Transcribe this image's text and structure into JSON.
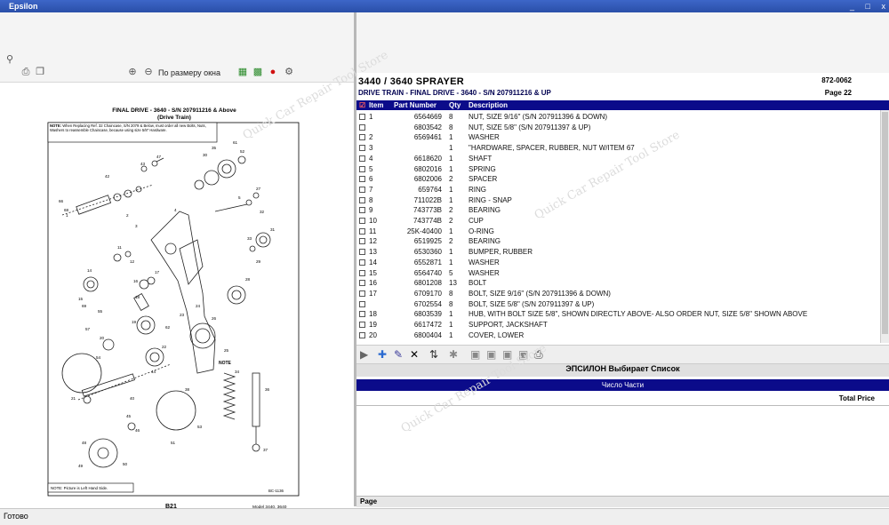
{
  "window": {
    "title": "Epsilon",
    "minimize": "_",
    "maximize": "□",
    "close": "x"
  },
  "left_toolbar": {
    "zoom_label": "По размеру окна"
  },
  "diagram": {
    "title": "FINAL DRIVE - 3640 - S/N 207911216 & Above",
    "subtitle": "(Drive Train)",
    "note_top_label": "NOTE:",
    "note_top_text": "When Replacing Ref. 32 Chaincase, S/N 2079 & Below, must order all new Bolts, Nuts, Washers to reassemble Chaincase, because using size 5/8\" Hardware.",
    "note_bottom": "NOTE: Picture is Left Hand Side.",
    "code": "BC-1136",
    "page_ref": "B21",
    "model_line1": "Model 3440, 3640",
    "model_line2": "Spra-Coupe Parts",
    "callouts": [
      "47",
      "43",
      "42",
      "35",
      "30",
      "61",
      "52",
      "27",
      "5",
      "1",
      "2",
      "3",
      "4",
      "11",
      "12",
      "14",
      "15",
      "16",
      "17",
      "18",
      "19",
      "20",
      "21",
      "22",
      "23",
      "24",
      "25",
      "26",
      "28",
      "29",
      "31",
      "32",
      "33",
      "34",
      "36",
      "37",
      "38",
      "40",
      "44",
      "45",
      "46",
      "48",
      "49",
      "50",
      "51",
      "53",
      "54",
      "55",
      "57",
      "62",
      "66",
      "68",
      "69"
    ]
  },
  "header": {
    "model_title": "3440 / 3640 SPRAYER",
    "model_code": "872-0062",
    "section_title": "DRIVE TRAIN - FINAL DRIVE - 3640 - S/N 207911216 & UP",
    "page_label": "Page 22"
  },
  "columns": {
    "item": "Item",
    "part_number": "Part Number",
    "qty": "Qty",
    "description": "Description"
  },
  "rows": [
    {
      "item": "1",
      "part": "6564669",
      "qty": "8",
      "desc": "NUT, SIZE 9/16\" (S/N 207911396 & DOWN)"
    },
    {
      "item": "",
      "part": "6803542",
      "qty": "8",
      "desc": "NUT, SIZE 5/8\" (S/N 207911397 & UP)"
    },
    {
      "item": "2",
      "part": "6569461",
      "qty": "1",
      "desc": "WASHER"
    },
    {
      "item": "3",
      "part": "",
      "qty": "1",
      "desc": "\"HARDWARE, SPACER, RUBBER, NUT W/ITEM 67"
    },
    {
      "item": "4",
      "part": "6618620",
      "qty": "1",
      "desc": "SHAFT"
    },
    {
      "item": "5",
      "part": "6802016",
      "qty": "1",
      "desc": "SPRING"
    },
    {
      "item": "6",
      "part": "6802006",
      "qty": "2",
      "desc": "SPACER"
    },
    {
      "item": "7",
      "part": "659764",
      "qty": "1",
      "desc": "RING"
    },
    {
      "item": "8",
      "part": "711022B",
      "qty": "1",
      "desc": "RING - SNAP"
    },
    {
      "item": "9",
      "part": "743773B",
      "qty": "2",
      "desc": "BEARING"
    },
    {
      "item": "10",
      "part": "743774B",
      "qty": "2",
      "desc": "CUP"
    },
    {
      "item": "11",
      "part": "25K-40400",
      "qty": "1",
      "desc": "O-RING"
    },
    {
      "item": "12",
      "part": "6519925",
      "qty": "2",
      "desc": "BEARING"
    },
    {
      "item": "13",
      "part": "6530360",
      "qty": "1",
      "desc": "BUMPER, RUBBER"
    },
    {
      "item": "14",
      "part": "6552871",
      "qty": "1",
      "desc": "WASHER"
    },
    {
      "item": "15",
      "part": "6564740",
      "qty": "5",
      "desc": "WASHER"
    },
    {
      "item": "16",
      "part": "6801208",
      "qty": "13",
      "desc": "BOLT"
    },
    {
      "item": "17",
      "part": "6709170",
      "qty": "8",
      "desc": "BOLT, SIZE 9/16\" (S/N 207911396 & DOWN)"
    },
    {
      "item": "",
      "part": "6702554",
      "qty": "8",
      "desc": "BOLT, SIZE 5/8\" (S/N 207911397 & UP)"
    },
    {
      "item": "18",
      "part": "6803539",
      "qty": "1",
      "desc": "HUB, WITH BOLT SIZE 5/8\", SHOWN DIRECTLY ABOVE- ALSO ORDER NUT, SIZE 5/8\" SHOWN ABOVE"
    },
    {
      "item": "19",
      "part": "6617472",
      "qty": "1",
      "desc": "SUPPORT, JACKSHAFT"
    },
    {
      "item": "20",
      "part": "6800404",
      "qty": "1",
      "desc": "COVER, LOWER"
    }
  ],
  "list_panel": {
    "title": "ЭПСИЛОН Выбирает Список",
    "count_label": "Число Части",
    "total_price_label": "Total Price",
    "page_label": "Page"
  },
  "status": {
    "text": "Готово"
  },
  "watermark": "Quick Car Repair Tool Store"
}
